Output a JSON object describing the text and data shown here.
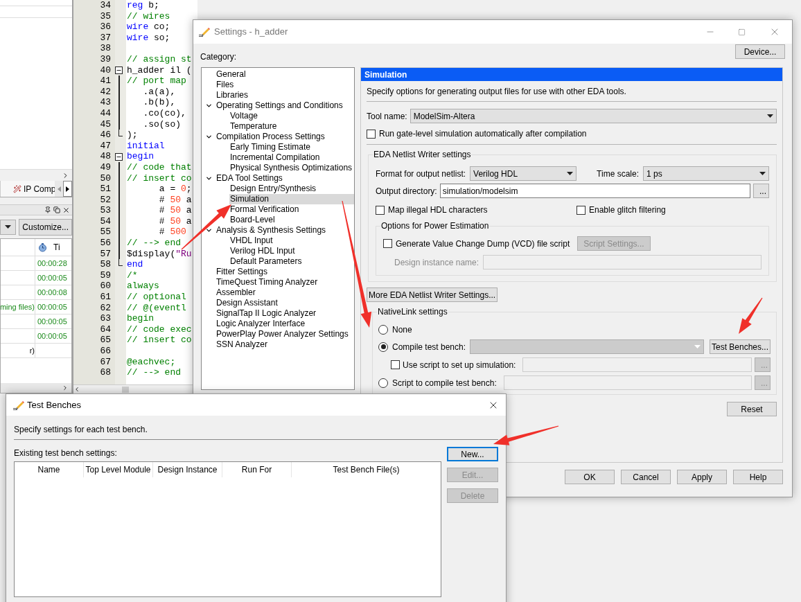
{
  "left_panel": {
    "tab": {
      "label": "IP Comp"
    },
    "customize_button": "Customize...",
    "table": {
      "column_2": "Ti",
      "rows": [
        {
          "column_2": "00:00:28"
        },
        {
          "column_2": "00:00:05"
        },
        {
          "column_2": "00:00:08"
        },
        {
          "column_1": {
            "text": "ming files)",
            "color": "#1a8a1a"
          },
          "column_2": "00:00:05"
        },
        {
          "column_2": "00:00:05"
        },
        {
          "column_2": "00:00:05"
        },
        {
          "column_1": {
            "text": "r)"
          }
        }
      ]
    }
  },
  "editor": {
    "lines": [
      {
        "number": "34",
        "tokens": [
          {
            "kind": "keyword",
            "text": "reg"
          },
          {
            "kind": "plain",
            "text": " b;"
          }
        ]
      },
      {
        "number": "35",
        "tokens": [
          {
            "kind": "comment",
            "text": "// wires"
          }
        ]
      },
      {
        "number": "36",
        "tokens": [
          {
            "kind": "keyword",
            "text": "wire"
          },
          {
            "kind": "plain",
            "text": " co;"
          }
        ]
      },
      {
        "number": "37",
        "tokens": [
          {
            "kind": "keyword",
            "text": "wire"
          },
          {
            "kind": "plain",
            "text": " so;"
          }
        ]
      },
      {
        "number": "38"
      },
      {
        "number": "39",
        "tokens": [
          {
            "kind": "comment",
            "text": "// assign st"
          }
        ]
      },
      {
        "number": "40",
        "fold_start": true,
        "tokens": [
          {
            "kind": "plain",
            "text": "h_adder il ("
          }
        ]
      },
      {
        "number": "41",
        "in_fold": true,
        "tokens": [
          {
            "kind": "comment",
            "text": "// port map"
          }
        ]
      },
      {
        "number": "42",
        "in_fold": true,
        "tokens": [
          {
            "kind": "plain",
            "text": "   .a(a),"
          }
        ]
      },
      {
        "number": "43",
        "in_fold": true,
        "tokens": [
          {
            "kind": "plain",
            "text": "   .b(b),"
          }
        ]
      },
      {
        "number": "44",
        "in_fold": true,
        "tokens": [
          {
            "kind": "plain",
            "text": "   .co(co),"
          }
        ]
      },
      {
        "number": "45",
        "in_fold": true,
        "tokens": [
          {
            "kind": "plain",
            "text": "   .so(so)"
          }
        ]
      },
      {
        "number": "46",
        "fold_end": true,
        "tokens": [
          {
            "kind": "plain",
            "text": ");"
          }
        ]
      },
      {
        "number": "47",
        "tokens": [
          {
            "kind": "keyword",
            "text": "initial"
          }
        ]
      },
      {
        "number": "48",
        "fold_start": true,
        "tokens": [
          {
            "kind": "keyword",
            "text": "begin"
          }
        ]
      },
      {
        "number": "49",
        "in_fold": true,
        "tokens": [
          {
            "kind": "comment",
            "text": "// code that"
          }
        ]
      },
      {
        "number": "50",
        "in_fold": true,
        "tokens": [
          {
            "kind": "comment",
            "text": "// insert co"
          }
        ]
      },
      {
        "number": "51",
        "in_fold": true,
        "tokens": [
          {
            "kind": "plain",
            "text": "      a = "
          },
          {
            "kind": "number",
            "text": "0"
          },
          {
            "kind": "plain",
            "text": ";"
          }
        ]
      },
      {
        "number": "52",
        "in_fold": true,
        "tokens": [
          {
            "kind": "plain",
            "text": "      # "
          },
          {
            "kind": "number",
            "text": "50"
          },
          {
            "kind": "plain",
            "text": " a"
          }
        ]
      },
      {
        "number": "53",
        "in_fold": true,
        "tokens": [
          {
            "kind": "plain",
            "text": "      # "
          },
          {
            "kind": "number",
            "text": "50"
          },
          {
            "kind": "plain",
            "text": " a"
          }
        ]
      },
      {
        "number": "54",
        "in_fold": true,
        "tokens": [
          {
            "kind": "plain",
            "text": "      # "
          },
          {
            "kind": "number",
            "text": "50"
          },
          {
            "kind": "plain",
            "text": " a"
          }
        ]
      },
      {
        "number": "55",
        "in_fold": true,
        "tokens": [
          {
            "kind": "plain",
            "text": "      # "
          },
          {
            "kind": "number",
            "text": "500"
          }
        ]
      },
      {
        "number": "56",
        "in_fold": true,
        "tokens": [
          {
            "kind": "comment",
            "text": "// --> end"
          }
        ]
      },
      {
        "number": "57",
        "in_fold": true,
        "tokens": [
          {
            "kind": "plain",
            "text": "$display("
          },
          {
            "kind": "string",
            "text": "\"Ru"
          }
        ]
      },
      {
        "number": "58",
        "fold_end": true,
        "tokens": [
          {
            "kind": "keyword",
            "text": "end"
          }
        ]
      },
      {
        "number": "59",
        "tokens": [
          {
            "kind": "comment",
            "text": "/*"
          }
        ]
      },
      {
        "number": "60",
        "tokens": [
          {
            "kind": "comment",
            "text": "always"
          }
        ]
      },
      {
        "number": "61",
        "tokens": [
          {
            "kind": "comment",
            "text": "// optional"
          }
        ]
      },
      {
        "number": "62",
        "tokens": [
          {
            "kind": "comment",
            "text": "// @(eventl"
          }
        ]
      },
      {
        "number": "63",
        "tokens": [
          {
            "kind": "comment",
            "text": "begin"
          }
        ]
      },
      {
        "number": "64",
        "tokens": [
          {
            "kind": "comment",
            "text": "// code exec"
          }
        ]
      },
      {
        "number": "65",
        "tokens": [
          {
            "kind": "comment",
            "text": "// insert co"
          }
        ]
      },
      {
        "number": "66"
      },
      {
        "number": "67",
        "tokens": [
          {
            "kind": "comment",
            "text": "@eachvec;"
          }
        ]
      },
      {
        "number": "68",
        "tokens": [
          {
            "kind": "comment",
            "text": "// --> end"
          }
        ]
      }
    ]
  },
  "settings": {
    "title": "Settings - h_adder",
    "category_label": "Category:",
    "device_button": "Device...",
    "tree": [
      {
        "label": "General",
        "selected": false
      },
      {
        "label": "Files",
        "selected": false
      },
      {
        "label": "Libraries",
        "selected": false
      },
      {
        "label": "Operating Settings and Conditions",
        "selected": false,
        "expanded": true,
        "children": [
          {
            "label": "Voltage",
            "selected": false
          },
          {
            "label": "Temperature",
            "selected": false
          }
        ]
      },
      {
        "label": "Compilation Process Settings",
        "selected": false,
        "expanded": true,
        "children": [
          {
            "label": "Early Timing Estimate",
            "selected": false
          },
          {
            "label": "Incremental Compilation",
            "selected": false
          },
          {
            "label": "Physical Synthesis Optimizations",
            "selected": false
          }
        ]
      },
      {
        "label": "EDA Tool Settings",
        "selected": false,
        "expanded": true,
        "children": [
          {
            "label": "Design Entry/Synthesis",
            "selected": false
          },
          {
            "label": "Simulation",
            "selected": true
          },
          {
            "label": "Formal Verification",
            "selected": false
          },
          {
            "label": "Board-Level",
            "selected": false
          }
        ]
      },
      {
        "label": "Analysis & Synthesis Settings",
        "selected": false,
        "expanded": true,
        "children": [
          {
            "label": "VHDL Input",
            "selected": false
          },
          {
            "label": "Verilog HDL Input",
            "selected": false
          },
          {
            "label": "Default Parameters",
            "selected": false
          }
        ]
      },
      {
        "label": "Fitter Settings",
        "selected": false
      },
      {
        "label": "TimeQuest Timing Analyzer",
        "selected": false
      },
      {
        "label": "Assembler",
        "selected": false
      },
      {
        "label": "Design Assistant",
        "selected": false
      },
      {
        "label": "SignalTap II Logic Analyzer",
        "selected": false
      },
      {
        "label": "Logic Analyzer Interface",
        "selected": false
      },
      {
        "label": "PowerPlay Power Analyzer Settings",
        "selected": false
      },
      {
        "label": "SSN Analyzer",
        "selected": false
      }
    ],
    "panel": {
      "header": "Simulation",
      "description": "Specify options for generating output files for use with other EDA tools.",
      "tool_name": {
        "label": "Tool name:",
        "value": "ModelSim-Altera"
      },
      "run_gate_level": {
        "label": "Run gate-level simulation automatically after compilation",
        "checked": false
      },
      "netlist_group": {
        "title": "EDA Netlist Writer settings",
        "format": {
          "label": "Format for output netlist:",
          "value": "Verilog HDL"
        },
        "time_scale": {
          "label": "Time scale:",
          "value": "1 ps"
        },
        "output_directory": {
          "label": "Output directory:",
          "value": "simulation/modelsim",
          "browse": "..."
        },
        "map_illegal": {
          "label": "Map illegal HDL characters",
          "checked": false
        },
        "glitch": {
          "label": "Enable glitch filtering",
          "checked": false
        },
        "power": {
          "title": "Options for Power Estimation",
          "vcd": {
            "label": "Generate Value Change Dump (VCD) file script",
            "checked": false
          },
          "script_settings": {
            "label": "Script Settings...",
            "disabled": true
          },
          "design_instance": {
            "label": "Design instance name:",
            "disabled": true
          }
        }
      },
      "more_button": "More EDA Netlist Writer Settings...",
      "nativelink": {
        "title": "NativeLink settings",
        "none": {
          "label": "None",
          "selected": false
        },
        "compile": {
          "label": "Compile test bench:",
          "selected": true,
          "dropdown_disabled": true
        },
        "test_benches_button": "Test Benches...",
        "use_script": {
          "label": "Use script to set up simulation:",
          "checked": false,
          "browse": "..."
        },
        "script_compile": {
          "label": "Script to compile test bench:",
          "selected": false,
          "browse": "..."
        }
      },
      "reset_button": "Reset"
    },
    "buttons": [
      "OK",
      "Cancel",
      "Apply",
      "Help"
    ]
  },
  "test_benches": {
    "title": "Test Benches",
    "description": "Specify settings for each test bench.",
    "existing_label": "Existing test bench settings:",
    "columns": [
      "Name",
      "Top Level Module",
      "Design Instance",
      "Run For",
      "Test Bench File(s)"
    ],
    "buttons": [
      {
        "label": "New...",
        "disabled": false,
        "focused": true
      },
      {
        "label": "Edit...",
        "disabled": true,
        "focused": false
      },
      {
        "label": "Delete",
        "disabled": true,
        "focused": false
      }
    ]
  }
}
